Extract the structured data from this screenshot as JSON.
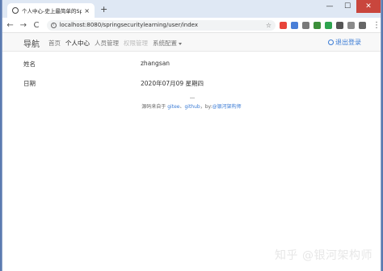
{
  "browser": {
    "tab_title": "个人中心-史上最简单的Spring S",
    "tab_close": "×",
    "new_tab": "+",
    "url": "localhost:8080/springsecuritylearning/user/index",
    "nav_back": "←",
    "nav_forward": "→",
    "nav_reload": "C",
    "star": "☆",
    "menu": "⋮",
    "win_minimize": "—",
    "win_maximize": "☐",
    "win_close": "✕",
    "extension_colors": [
      "#e8443a",
      "#4a7fd8",
      "#7a7a7a",
      "#3c8f3a",
      "#2ea44f",
      "#555555",
      "#8a8a8a",
      "#666666"
    ]
  },
  "navbar": {
    "brand": "导航",
    "links": [
      {
        "label": "首页",
        "state": "normal"
      },
      {
        "label": "个人中心",
        "state": "active"
      },
      {
        "label": "人员管理",
        "state": "normal"
      },
      {
        "label": "权限管理",
        "state": "disabled"
      },
      {
        "label": "系统配置",
        "state": "dropdown"
      }
    ],
    "logout": "退出登录"
  },
  "profile": {
    "name_label": "姓名",
    "name_value": "zhangsan",
    "date_label": "日期",
    "date_value": "2020年07月09 星期四"
  },
  "footer": {
    "prefix": "源码来自于",
    "link_gitee": "gitee",
    "sep1": "、",
    "link_github": "github",
    "by": "，by:",
    "link_author": "@银河架构师"
  },
  "watermark": "知乎 @银河架构师"
}
